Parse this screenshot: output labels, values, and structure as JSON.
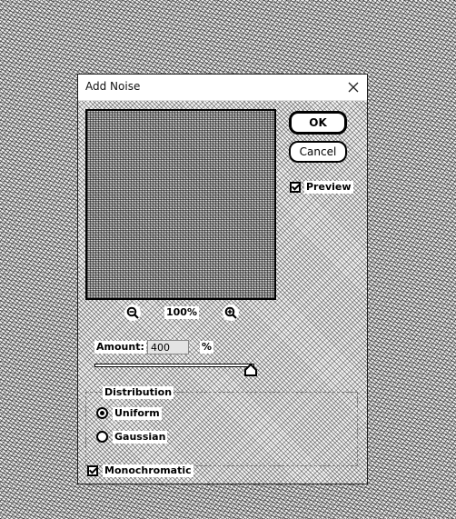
{
  "dialog": {
    "title": "Add Noise",
    "close_glyph": "✕",
    "buttons": {
      "ok": "OK",
      "cancel": "Cancel"
    },
    "preview": {
      "label": "Preview",
      "checked": true
    },
    "zoom": {
      "level": "100%",
      "zoom_out_icon": "zoom-out-icon",
      "zoom_in_icon": "zoom-in-icon"
    },
    "amount": {
      "label": "Amount:",
      "value": "400",
      "unit": "%"
    },
    "distribution": {
      "label": "Distribution",
      "options": [
        {
          "label": "Uniform",
          "selected": true
        },
        {
          "label": "Gaussian",
          "selected": false
        }
      ]
    },
    "monochromatic": {
      "label": "Monochromatic",
      "checked": true
    }
  }
}
